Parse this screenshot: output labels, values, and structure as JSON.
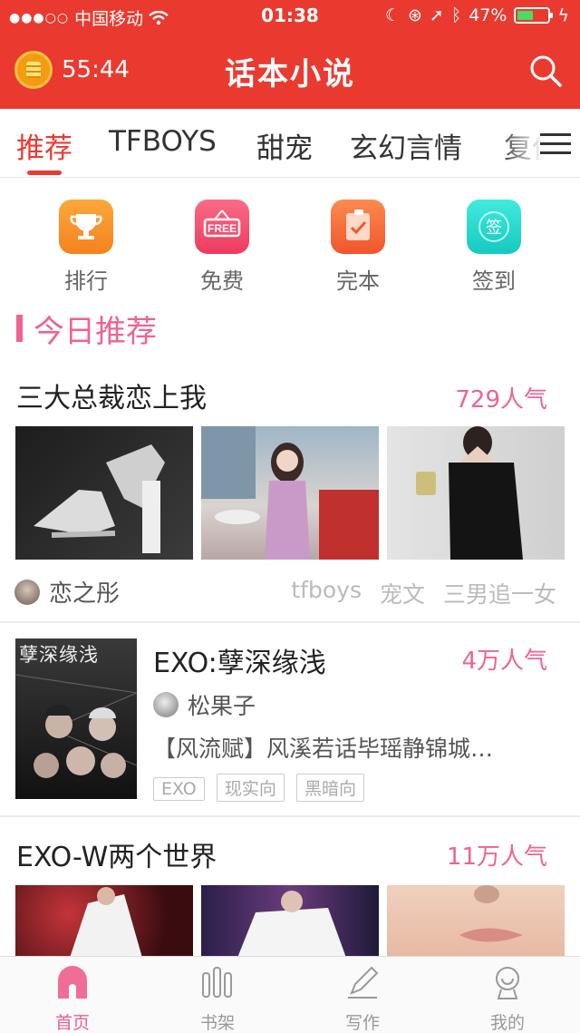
{
  "status": {
    "carrier": "中国移动",
    "time": "01:38",
    "battery": "47%"
  },
  "header": {
    "timer": "55:44",
    "title": "话本小说"
  },
  "tabs": [
    {
      "label": "推荐"
    },
    {
      "label": "TFBOYS"
    },
    {
      "label": "甜宠"
    },
    {
      "label": "玄幻言情"
    },
    {
      "label": "复仇"
    }
  ],
  "quick": [
    {
      "label": "排行",
      "icon": "trophy-icon",
      "color": "#f5901e"
    },
    {
      "label": "免费",
      "icon": "free-sign-icon",
      "color": "#f0506e",
      "badge": "FREE"
    },
    {
      "label": "完本",
      "icon": "check-note-icon",
      "color": "#f26a3c"
    },
    {
      "label": "签到",
      "icon": "sign-in-icon",
      "color": "#22d6c9",
      "badge": "签"
    }
  ],
  "section": {
    "title": "今日推荐"
  },
  "cards": [
    {
      "title": "三大总裁恋上我",
      "popularity": "729人气",
      "author": "恋之彤",
      "tags": [
        "tfboys",
        "宠文",
        "三男追一女"
      ]
    },
    {
      "title": "EXO:孽深缘浅",
      "popularity": "4万人气",
      "author": "松果子",
      "desc": "【风流赋】风溪若话毕瑶静锦城…",
      "cover_text": "孽深缘浅",
      "tags": [
        "EXO",
        "现实向",
        "黑暗向"
      ]
    },
    {
      "title": "EXO-W两个世界",
      "popularity": "11万人气"
    }
  ],
  "bottom_nav": [
    {
      "label": "首页",
      "active": true
    },
    {
      "label": "书架"
    },
    {
      "label": "写作"
    },
    {
      "label": "我的"
    }
  ],
  "colors": {
    "brand": "#ea3a30",
    "accent": "#f06292"
  }
}
